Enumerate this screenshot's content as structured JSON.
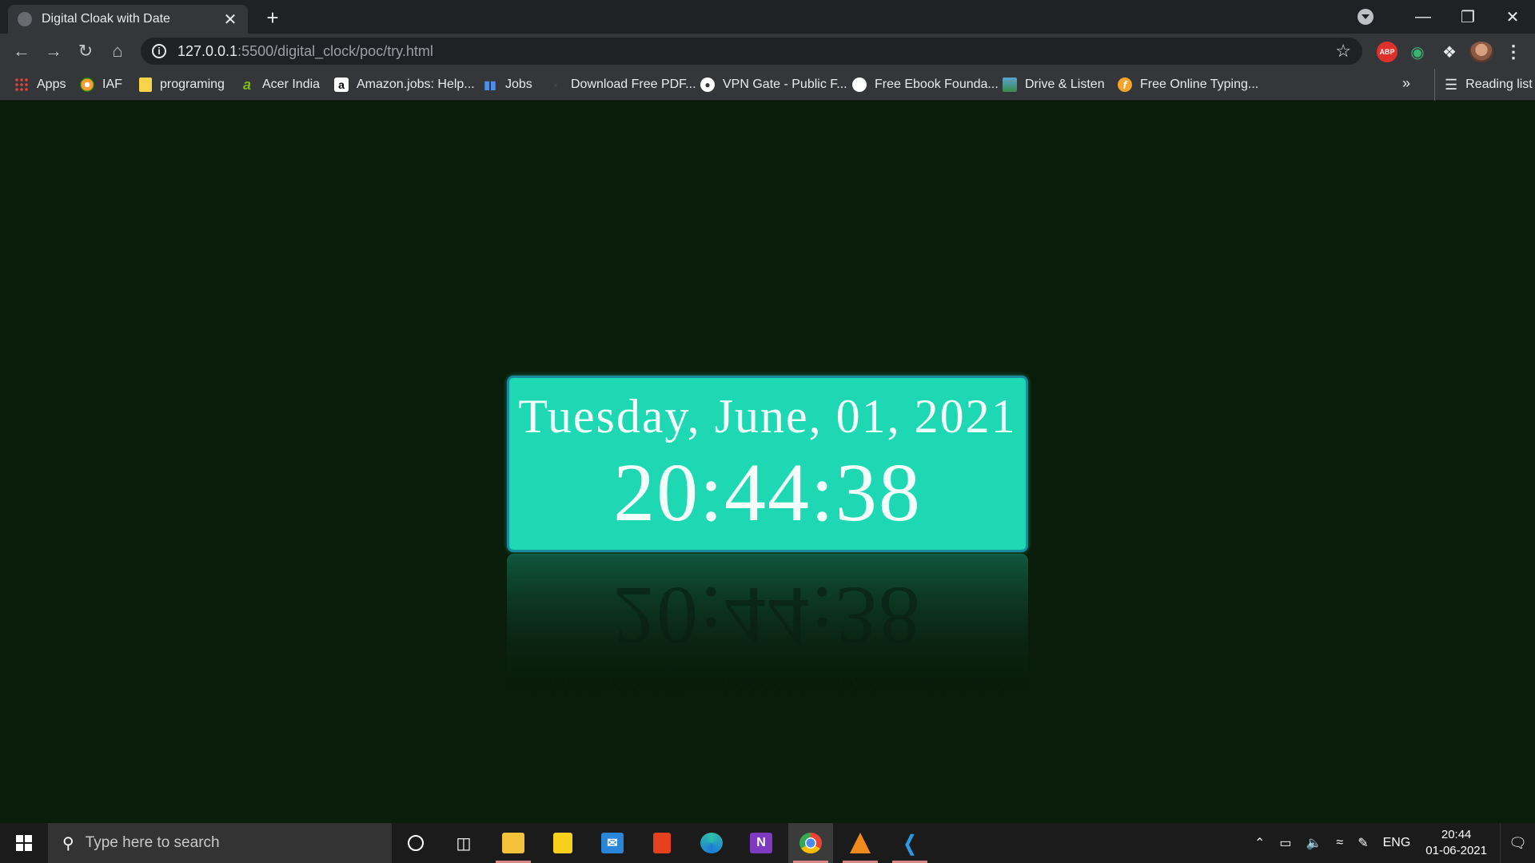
{
  "browser": {
    "tab_title": "Digital Cloak with Date",
    "tab_close": "✕",
    "new_tab": "+",
    "url_host": "127.0.0.1",
    "url_path": ":5500/digital_clock/poc/try.html",
    "bookmarks": [
      {
        "label": "Apps",
        "icon": "apps-grid-icon"
      },
      {
        "label": "IAF",
        "icon": "iaf-icon"
      },
      {
        "label": "programing",
        "icon": "folder-icon"
      },
      {
        "label": "Acer India",
        "icon": "acer-icon"
      },
      {
        "label": "Amazon.jobs: Help...",
        "icon": "amazon-icon"
      },
      {
        "label": "Jobs",
        "icon": "chart-icon"
      },
      {
        "label": "Download Free PDF...",
        "icon": "pdf-icon"
      },
      {
        "label": "VPN Gate - Public F...",
        "icon": "globe-icon"
      },
      {
        "label": "Free Ebook Founda...",
        "icon": "github-icon"
      },
      {
        "label": "Drive & Listen",
        "icon": "drive-listen-icon"
      },
      {
        "label": "Free Online Typing...",
        "icon": "typing-icon"
      }
    ],
    "bookmarks_more": "»",
    "reading_list": "Reading list",
    "abp_label": "ABP"
  },
  "page": {
    "date": "Tuesday, June, 01, 2021",
    "time": "20:44:38"
  },
  "taskbar": {
    "search_placeholder": "Type here to search",
    "apps": [
      "cortana",
      "task-view",
      "file-explorer",
      "sticky-notes",
      "mail",
      "office",
      "edge",
      "onenote",
      "chrome",
      "vlc",
      "vscode"
    ],
    "language": "ENG",
    "time": "20:44",
    "date": "01-06-2021"
  },
  "colors": {
    "clock_bg": "#1ed8b4",
    "page_bg": "#0a1c0a",
    "clock_text": "#f3fffb"
  }
}
